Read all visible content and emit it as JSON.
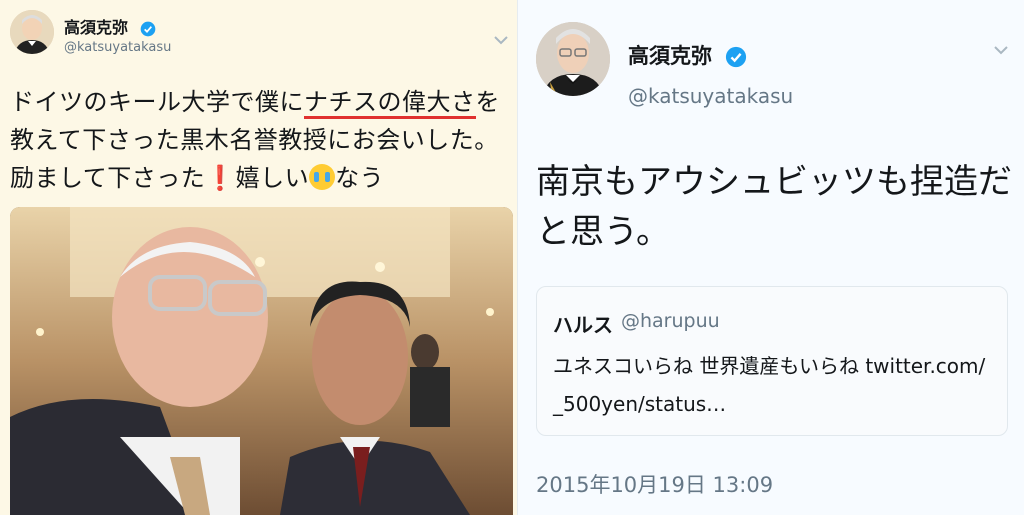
{
  "left_tweet": {
    "author_name": "高須克弥",
    "author_handle": "@katsuyatakasu",
    "verified_icon": "verified-badge-icon",
    "text_part1": "ドイツのキール大学で僕に",
    "text_underlined": "ナチスの偉大さ",
    "text_part2": "を教えて下さった黒木名誉教授にお会いした。励まして下さった",
    "text_exclaim": "❗",
    "text_part3": "嬉しい",
    "text_part4": "なう",
    "photo_description_icon": "selfie-photo"
  },
  "right_tweet": {
    "author_name": "高須克弥",
    "author_handle": "@katsuyatakasu",
    "verified_icon": "verified-badge-icon",
    "text": "南京もアウシュビッツも捏造だと思う。",
    "quoted": {
      "name": "ハルス",
      "handle": "@harupuu",
      "text_line1": "ユネスコいらね 世界遺産もいらね twitter.com/",
      "text_line2": "_500yen/status…"
    },
    "timestamp": "2015年10月19日 13:09"
  },
  "colors": {
    "twitter_blue": "#1da1f2",
    "underline_red": "#e0312f",
    "text_dark": "#14171a",
    "text_grey": "#657786"
  }
}
